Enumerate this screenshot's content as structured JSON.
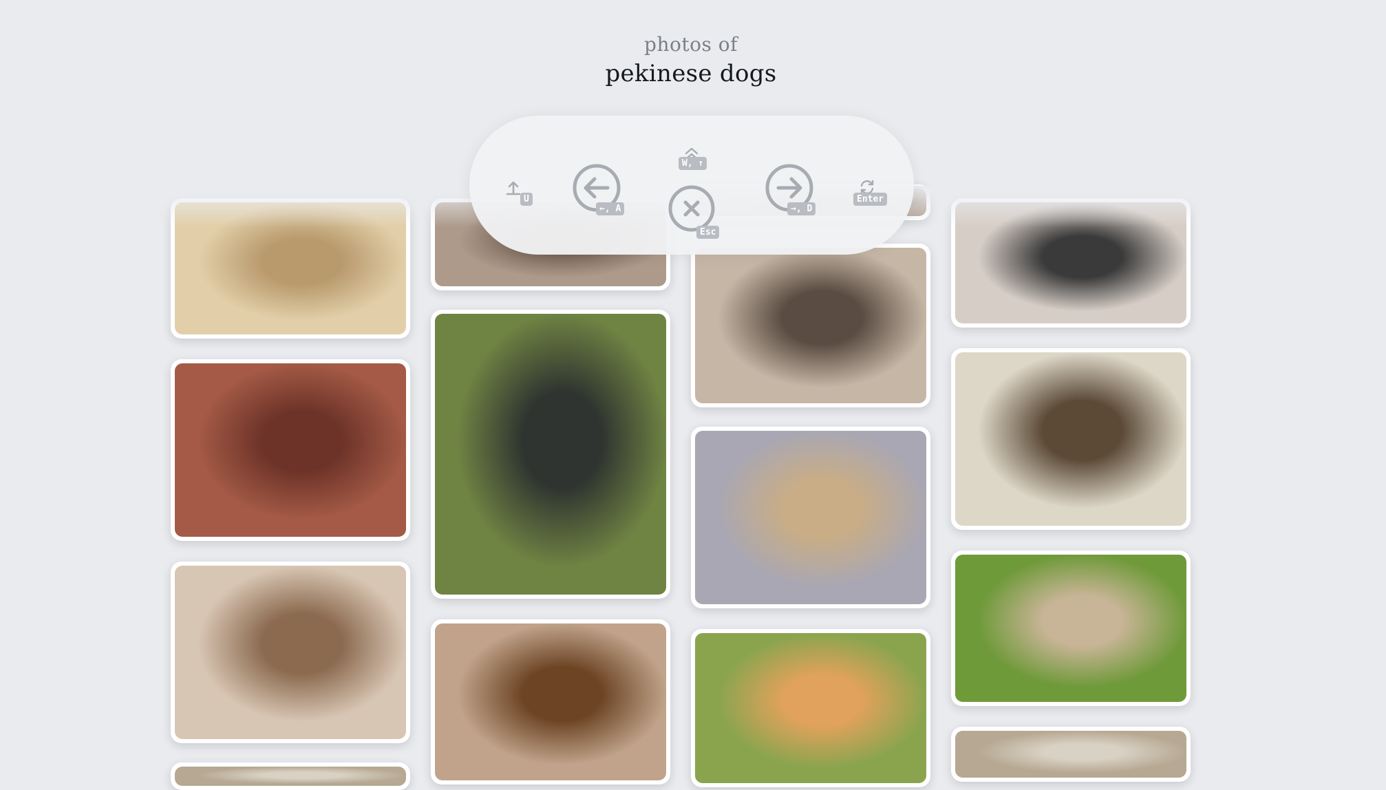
{
  "header": {
    "subtitle": "photos of",
    "title": "pekinese dogs"
  },
  "toolbar": {
    "buttons": [
      {
        "name": "upload-icon",
        "hotkey": "U"
      },
      {
        "name": "previous-icon",
        "hotkey": "←, A"
      },
      {
        "name": "collapse-icon",
        "hotkey": "W, ↑"
      },
      {
        "name": "close-icon",
        "hotkey": "Esc"
      },
      {
        "name": "next-icon",
        "hotkey": "→, D"
      },
      {
        "name": "refresh-icon",
        "hotkey": "Enter"
      }
    ]
  },
  "photos": [
    {
      "subject": "pekinese lying on carpet",
      "colors": [
        "#e2cfa9",
        "#b99a6d"
      ]
    },
    {
      "subject": "pekinese on red couch",
      "colors": [
        "#a45a46",
        "#6d3328"
      ]
    },
    {
      "subject": "pekinese at window",
      "colors": [
        "#d8c6b4",
        "#8b6a4f"
      ]
    },
    {
      "subject": "dog legs on floor",
      "colors": [
        "#ad9a8a",
        "#7a6659"
      ]
    },
    {
      "subject": "dark pekinese on grass",
      "colors": [
        "#6f8343",
        "#2f3430"
      ]
    },
    {
      "subject": "fluffy pekinese on rug",
      "colors": [
        "#c0a38a",
        "#6d4525"
      ]
    },
    {
      "subject": "pekinese with person sitting",
      "colors": [
        "#c6b6a6",
        "#5a4c42"
      ]
    },
    {
      "subject": "pekinese close-up portrait",
      "colors": [
        "#a9a7b3",
        "#c8ad87"
      ]
    },
    {
      "subject": "long-haired pekinese on grass",
      "colors": [
        "#8aa44e",
        "#e0a25c"
      ]
    },
    {
      "subject": "pekinese on leash",
      "colors": [
        "#d6cdc6",
        "#3a3a3a"
      ]
    },
    {
      "subject": "pekinese puppy on chair",
      "colors": [
        "#ddd7c8",
        "#5c4a37"
      ]
    },
    {
      "subject": "cream pekinese on lawn",
      "colors": [
        "#6f9a3a",
        "#c8b496"
      ]
    },
    {
      "subject": "pekinese partial",
      "colors": [
        "#b6a893",
        "#d9d1c3"
      ]
    }
  ]
}
